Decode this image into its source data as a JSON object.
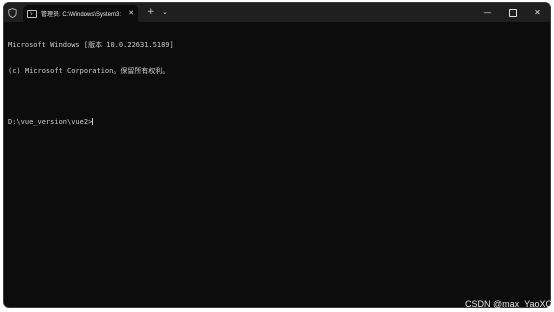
{
  "window": {
    "tab_title": "管理员: C:\\Windows\\System3:",
    "tab_close_glyph": "✕",
    "new_tab_glyph": "+",
    "tab_dropdown_glyph": "⌄",
    "minimize_glyph": "—",
    "close_glyph": "✕",
    "icons": {
      "shield": "shield-icon",
      "terminal": "terminal-icon",
      "minimize": "minimize-icon",
      "maximize": "maximize-icon",
      "close": "close-icon"
    }
  },
  "console": {
    "lines": [
      "Microsoft Windows [版本 10.0.22631.5189]",
      "(c) Microsoft Corporation。保留所有权利。",
      "",
      "D:\\vue_version\\vue2>"
    ]
  },
  "watermark": "CSDN @max_YaoXC",
  "colors": {
    "console_background": "#0c0c0c",
    "titlebar_background": "#1f1f1f",
    "console_text": "#cccccc"
  }
}
